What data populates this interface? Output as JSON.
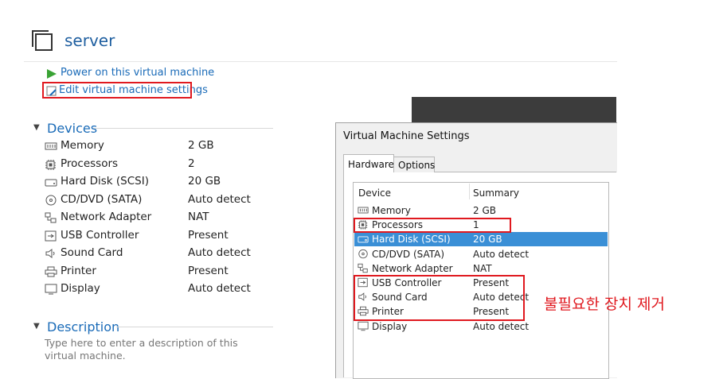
{
  "header": {
    "title": "server"
  },
  "actions": {
    "power_on": "Power on this virtual machine",
    "edit_settings": "Edit virtual machine settings"
  },
  "devices": {
    "header": "Devices",
    "items": [
      {
        "name": "Memory",
        "value": "2 GB",
        "icon": "memory-icon"
      },
      {
        "name": "Processors",
        "value": "2",
        "icon": "processor-icon"
      },
      {
        "name": "Hard Disk (SCSI)",
        "value": "20 GB",
        "icon": "hard-disk-icon"
      },
      {
        "name": "CD/DVD (SATA)",
        "value": "Auto detect",
        "icon": "cd-dvd-icon"
      },
      {
        "name": "Network Adapter",
        "value": "NAT",
        "icon": "network-adapter-icon"
      },
      {
        "name": "USB Controller",
        "value": "Present",
        "icon": "usb-icon"
      },
      {
        "name": "Sound Card",
        "value": "Auto detect",
        "icon": "sound-card-icon"
      },
      {
        "name": "Printer",
        "value": "Present",
        "icon": "printer-icon"
      },
      {
        "name": "Display",
        "value": "Auto detect",
        "icon": "display-icon"
      }
    ]
  },
  "description": {
    "header": "Description",
    "placeholder": "Type here to enter a description of this virtual machine."
  },
  "dialog": {
    "title": "Virtual Machine Settings",
    "tabs": [
      "Hardware",
      "Options"
    ],
    "columns": [
      "Device",
      "Summary"
    ],
    "rows": [
      {
        "name": "Memory",
        "value": "2 GB"
      },
      {
        "name": "Processors",
        "value": "1"
      },
      {
        "name": "Hard Disk (SCSI)",
        "value": "20 GB"
      },
      {
        "name": "CD/DVD (SATA)",
        "value": "Auto detect"
      },
      {
        "name": "Network Adapter",
        "value": "NAT"
      },
      {
        "name": "USB Controller",
        "value": "Present"
      },
      {
        "name": "Sound Card",
        "value": "Auto detect"
      },
      {
        "name": "Printer",
        "value": "Present"
      },
      {
        "name": "Display",
        "value": "Auto detect"
      }
    ],
    "selected_row": "Hard Disk (SCSI)"
  },
  "annotation": {
    "text": "불필요한 장치 제거",
    "color": "#e0191f"
  },
  "colors": {
    "accent": "#1a6bb8",
    "selection": "#3a8fd6",
    "highlight": "#e0191f",
    "play": "#3aa335"
  }
}
